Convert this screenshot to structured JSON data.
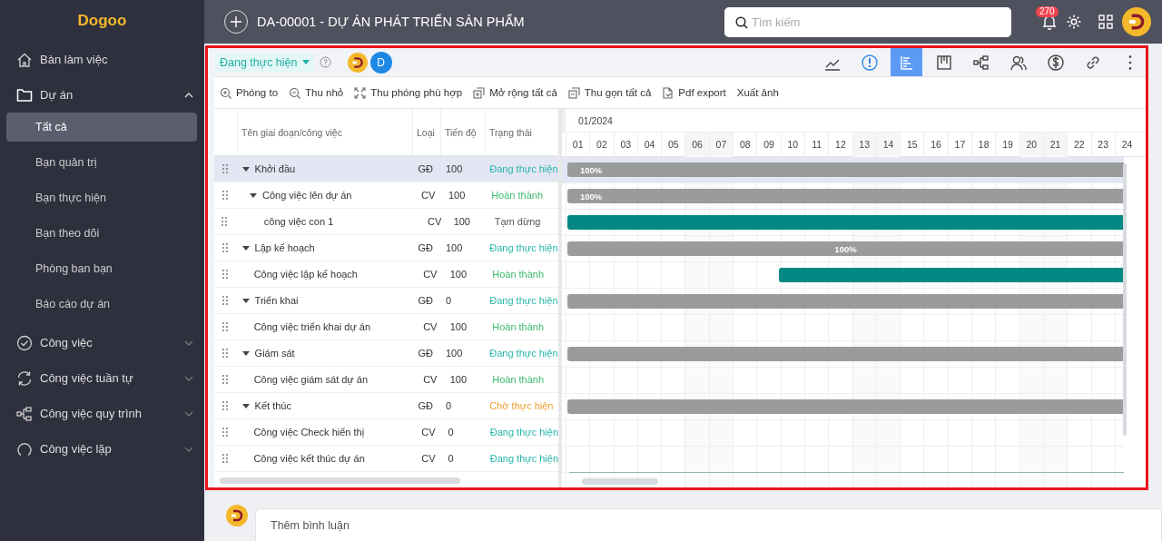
{
  "sidebar": {
    "logo": "Dogoo",
    "items": [
      {
        "kind": "home",
        "label": "Bàn làm việc",
        "selected": false
      },
      {
        "kind": "folder",
        "label": "Dự án",
        "expanded": true,
        "selected": false,
        "children": [
          {
            "label": "Tất cả",
            "selected": true
          },
          {
            "label": "Bạn quản trị",
            "selected": false
          },
          {
            "label": "Bạn thực hiện",
            "selected": false
          },
          {
            "label": "Bạn theo dõi",
            "selected": false
          },
          {
            "label": "Phòng ban bạn",
            "selected": false
          },
          {
            "label": "Báo cáo dự án",
            "selected": false
          }
        ]
      },
      {
        "kind": "check",
        "label": "Công việc",
        "expanded": false,
        "selected": false
      },
      {
        "kind": "sync",
        "label": "Công việc tuần tự",
        "expanded": false,
        "selected": false
      },
      {
        "kind": "flow",
        "label": "Công việc quy trình",
        "expanded": false,
        "selected": false
      },
      {
        "kind": "loop",
        "label": "Công việc lặp",
        "expanded": false,
        "selected": false
      }
    ]
  },
  "header": {
    "title": "DA-00001 - DỰ ÁN PHÁT TRIỂN SẢN PHẨM",
    "search": {
      "placeholder": "Tìm kiếm"
    },
    "notification_count": "270"
  },
  "panel": {
    "status": "Đang thực hiện",
    "members": [
      {
        "kind": "logo"
      },
      {
        "kind": "initial",
        "initial": "D"
      }
    ],
    "view_tabs": [
      {
        "kind": "chart",
        "selected": false
      },
      {
        "kind": "alert",
        "selected": false
      },
      {
        "kind": "gantt",
        "selected": true
      },
      {
        "kind": "board",
        "selected": false
      },
      {
        "kind": "flow",
        "selected": false
      },
      {
        "kind": "people",
        "selected": false
      },
      {
        "kind": "dollar",
        "selected": false
      },
      {
        "kind": "link",
        "selected": false
      },
      {
        "kind": "more",
        "selected": false
      }
    ],
    "toolbar": [
      {
        "kind": "zoom-in",
        "label": "Phóng to"
      },
      {
        "kind": "zoom-out",
        "label": "Thu nhỏ"
      },
      {
        "kind": "fit",
        "label": "Thu phóng phù hợp"
      },
      {
        "kind": "expand",
        "label": "Mở rộng tất cả"
      },
      {
        "kind": "collapse",
        "label": "Thu gọn tất cả"
      },
      {
        "kind": "pdf",
        "label": "Pdf export"
      },
      {
        "kind": "image",
        "label": "Xuất ảnh"
      }
    ]
  },
  "table": {
    "columns": [
      "Tên giai đoạn/công việc",
      "Loại",
      "Tiến độ",
      "Trạng thái"
    ],
    "rows": [
      {
        "name": "Khởi đầu",
        "type": "GĐ",
        "progress": "100",
        "status": "Đang thực hiện",
        "color": "#26b5aa",
        "selected": true,
        "expanded": true,
        "bar": {
          "kind": "phase",
          "level": 1,
          "label": "100%",
          "label_centered": false
        },
        "children": [
          {
            "name": "Công việc lên dự án",
            "type": "CV",
            "progress": "100",
            "status": "Hoàn thành",
            "color": "#3dba6f",
            "selected": false,
            "expanded": true,
            "bar": {
              "kind": "phase",
              "level": 1,
              "label": "100%",
              "label_centered": false
            },
            "children": [
              {
                "name": "công việc con 1",
                "type": "CV",
                "progress": "100",
                "status": "Tạm dừng",
                "color": "#555555",
                "selected": false,
                "bar": {
                  "kind": "task",
                  "level": 1
                }
              }
            ]
          }
        ]
      },
      {
        "name": "Lập kế hoạch",
        "type": "GĐ",
        "progress": "100",
        "status": "Đang thực hiện",
        "color": "#26b5aa",
        "selected": false,
        "expanded": true,
        "bar": {
          "kind": "phase",
          "level": 1,
          "label": "100%",
          "label_centered": true
        },
        "children": [
          {
            "name": "Công việc lập kế hoạch",
            "type": "CV",
            "progress": "100",
            "status": "Hoàn thành",
            "color": "#3dba6f",
            "selected": false,
            "bar": {
              "kind": "task",
              "level": 0.62
            }
          }
        ]
      },
      {
        "name": "Triển khai",
        "type": "GĐ",
        "progress": "0",
        "status": "Đang thực hiện",
        "color": "#26b5aa",
        "selected": false,
        "expanded": true,
        "bar": {
          "kind": "phase",
          "level": 1
        },
        "children": [
          {
            "name": "Công việc triển khai dự án",
            "type": "CV",
            "progress": "100",
            "status": "Hoàn thành",
            "color": "#3dba6f",
            "selected": false
          }
        ]
      },
      {
        "name": "Giám sát",
        "type": "GĐ",
        "progress": "100",
        "status": "Đang thực hiện",
        "color": "#26b5aa",
        "selected": false,
        "expanded": true,
        "bar": {
          "kind": "phase",
          "level": 1
        },
        "children": [
          {
            "name": "Công việc giám sát dự án",
            "type": "CV",
            "progress": "100",
            "status": "Hoàn thành",
            "color": "#3dba6f",
            "selected": false
          }
        ]
      },
      {
        "name": "Kết thúc",
        "type": "GĐ",
        "progress": "0",
        "status": "Chờ thực hiện",
        "color": "#f0a030",
        "selected": false,
        "expanded": true,
        "bar": {
          "kind": "phase",
          "level": 1
        },
        "children": [
          {
            "name": "Công việc Check hiển thị",
            "type": "CV",
            "progress": "0",
            "status": "Đang thực hiện",
            "color": "#26b5aa",
            "selected": false
          },
          {
            "name": "Công việc kết thúc dự án",
            "type": "CV",
            "progress": "0",
            "status": "Đang thực hiện",
            "color": "#26b5aa",
            "selected": false
          }
        ]
      }
    ]
  },
  "gantt": {
    "month": "01/2024",
    "days": [
      {
        "label": "01",
        "shaded": false
      },
      {
        "label": "02",
        "shaded": false
      },
      {
        "label": "03",
        "shaded": false
      },
      {
        "label": "04",
        "shaded": false
      },
      {
        "label": "05",
        "shaded": false
      },
      {
        "label": "06",
        "shaded": true
      },
      {
        "label": "07",
        "shaded": true
      },
      {
        "label": "08",
        "shaded": false
      },
      {
        "label": "09",
        "shaded": false
      },
      {
        "label": "10",
        "shaded": false
      },
      {
        "label": "11",
        "shaded": false
      },
      {
        "label": "12",
        "shaded": false
      },
      {
        "label": "13",
        "shaded": true
      },
      {
        "label": "14",
        "shaded": true
      },
      {
        "label": "15",
        "shaded": false
      },
      {
        "label": "16",
        "shaded": false
      },
      {
        "label": "17",
        "shaded": false
      },
      {
        "label": "18",
        "shaded": false
      },
      {
        "label": "19",
        "shaded": false
      },
      {
        "label": "20",
        "shaded": true
      },
      {
        "label": "21",
        "shaded": true
      },
      {
        "label": "22",
        "shaded": false
      },
      {
        "label": "23",
        "shaded": false
      },
      {
        "label": "24",
        "shaded": false
      }
    ]
  },
  "comment": {
    "placeholder": "Thêm bình luận"
  }
}
